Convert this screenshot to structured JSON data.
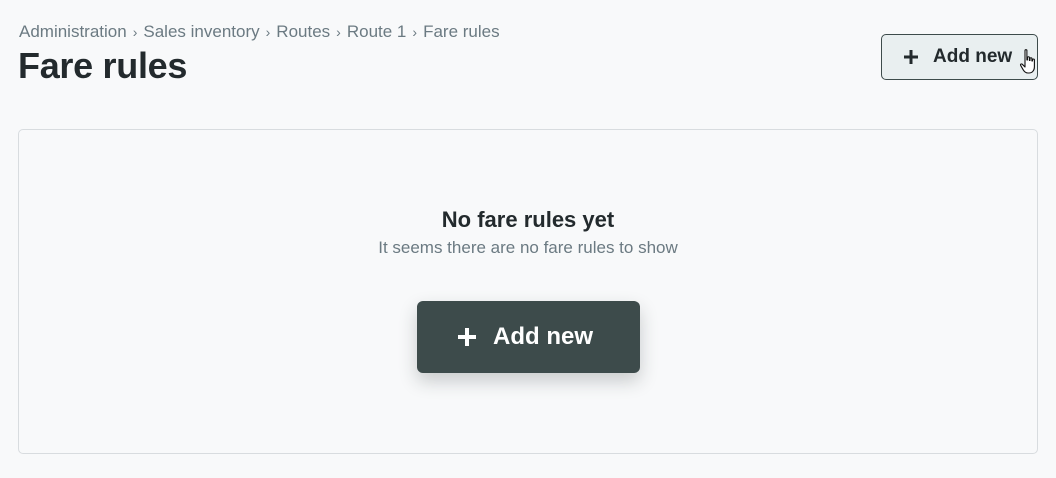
{
  "breadcrumb": {
    "items": [
      "Administration",
      "Sales inventory",
      "Routes",
      "Route 1",
      "Fare rules"
    ],
    "separator": "›"
  },
  "page": {
    "title": "Fare rules"
  },
  "header": {
    "add_button_label": "Add new",
    "add_button_icon": "plus-icon"
  },
  "empty_state": {
    "title": "No fare rules yet",
    "subtitle": "It seems there are no fare rules to show",
    "add_button_label": "Add new",
    "add_button_icon": "plus-icon"
  },
  "colors": {
    "background": "#f8f9fa",
    "primary_button": "#3d4b4b",
    "secondary_button_bg": "#e9eff0",
    "text_primary": "#232a2d",
    "text_muted": "#6b7a82",
    "card_border": "#d8dcdf"
  }
}
